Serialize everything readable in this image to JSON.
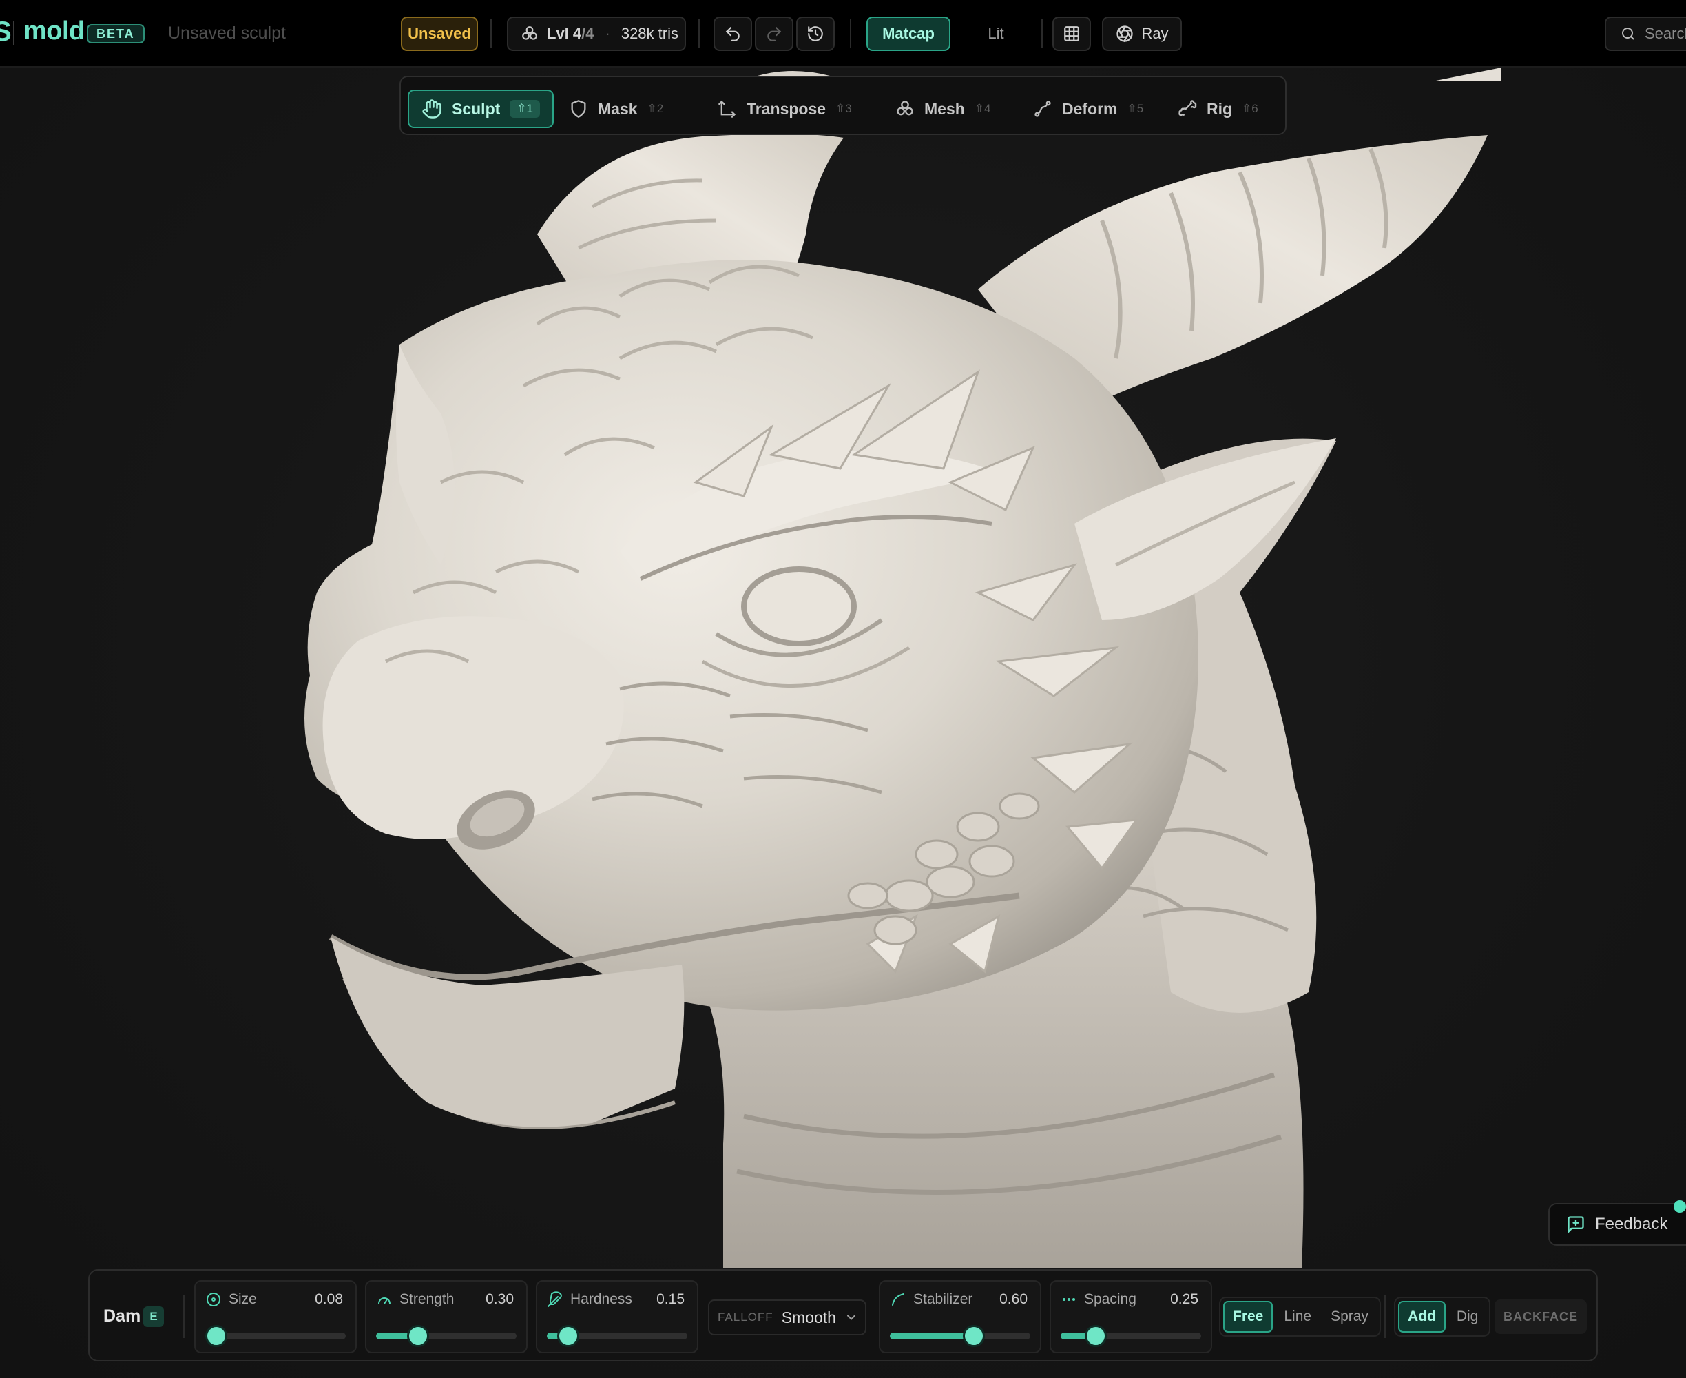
{
  "app": {
    "logo_prefix": "S",
    "name": "mold",
    "badge": "BETA",
    "document_name": "Unsaved sculpt",
    "colors": {
      "accent": "#6fe3c6",
      "warning": "#f1c04a"
    }
  },
  "topbar": {
    "status": "Unsaved",
    "level_label": "Lvl 4",
    "level_total": "/4",
    "tris": "328k tris",
    "undo_icon": "undo-icon",
    "redo_icon": "redo-icon",
    "history_icon": "history-icon",
    "render_modes": [
      "Matcap",
      "Lit"
    ],
    "active_render_mode": "Matcap",
    "grid_icon": "grid-icon",
    "ray_label": "Ray",
    "search_label": "Search"
  },
  "modes": [
    {
      "label": "Sculpt",
      "key": "⇧1",
      "icon": "hand-icon",
      "active": true
    },
    {
      "label": "Mask",
      "key": "⇧2",
      "icon": "shield-icon",
      "active": false
    },
    {
      "label": "Transpose",
      "key": "⇧3",
      "icon": "transpose-icon",
      "active": false
    },
    {
      "label": "Mesh",
      "key": "⇧4",
      "icon": "mesh-icon",
      "active": false
    },
    {
      "label": "Deform",
      "key": "⇧5",
      "icon": "deform-icon",
      "active": false
    },
    {
      "label": "Rig",
      "key": "⇧6",
      "icon": "bone-icon",
      "active": false
    }
  ],
  "brush": {
    "name": "Dam",
    "shortcut": "E",
    "params": [
      {
        "label": "Size",
        "value": "0.08",
        "level": 0.08,
        "icon": "size-icon"
      },
      {
        "label": "Strength",
        "value": "0.30",
        "level": 0.3,
        "icon": "strength-icon"
      },
      {
        "label": "Hardness",
        "value": "0.15",
        "level": 0.15,
        "icon": "feather-icon"
      },
      {
        "label": "Stabilizer",
        "value": "0.60",
        "level": 0.6,
        "icon": "stabilizer-icon"
      },
      {
        "label": "Spacing",
        "value": "0.25",
        "level": 0.25,
        "icon": "spacing-icon"
      }
    ],
    "falloff_label": "FALLOFF",
    "falloff_value": "Smooth",
    "stroke_modes": [
      "Free",
      "Line",
      "Spray"
    ],
    "active_stroke_mode": "Free",
    "direction_modes": [
      "Add",
      "Dig"
    ],
    "active_direction": "Add",
    "backface_label": "BACKFACE"
  },
  "feedback": {
    "label": "Feedback",
    "icon": "feedback-icon"
  }
}
